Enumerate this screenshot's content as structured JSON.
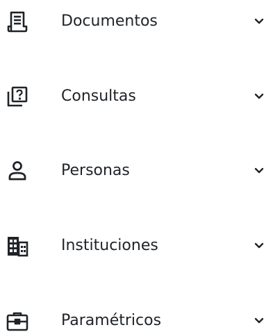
{
  "menu": {
    "items": [
      {
        "label": "Documentos",
        "icon": "document-icon"
      },
      {
        "label": "Consultas",
        "icon": "query-icon"
      },
      {
        "label": "Personas",
        "icon": "person-icon"
      },
      {
        "label": "Instituciones",
        "icon": "building-icon"
      },
      {
        "label": "Paramétricos",
        "icon": "briefcase-icon"
      }
    ]
  },
  "colors": {
    "text": "#1f2328",
    "icon": "#1f2328"
  }
}
